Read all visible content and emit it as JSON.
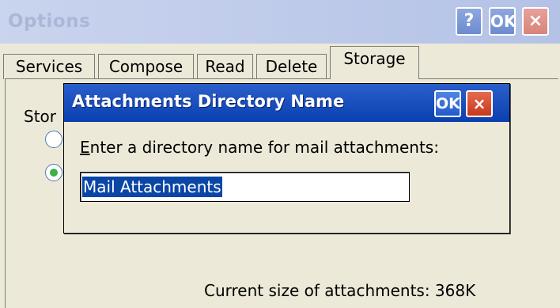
{
  "window": {
    "title": "Options",
    "help_label": "?",
    "ok_label": "OK",
    "close_label": "×"
  },
  "tabs": [
    {
      "label": "Services"
    },
    {
      "label": "Compose"
    },
    {
      "label": "Read"
    },
    {
      "label": "Delete"
    },
    {
      "label": "Storage",
      "active": true
    }
  ],
  "storage": {
    "label_visible": "Stor",
    "current_size_text": "Current size of attachments: 368K"
  },
  "dialog": {
    "title": "Attachments Directory Name",
    "ok_label": "OK",
    "close_label": "×",
    "prompt_first": "E",
    "prompt_rest": "nter a directory name for mail attachments:",
    "input_value": "Mail Attachments"
  }
}
